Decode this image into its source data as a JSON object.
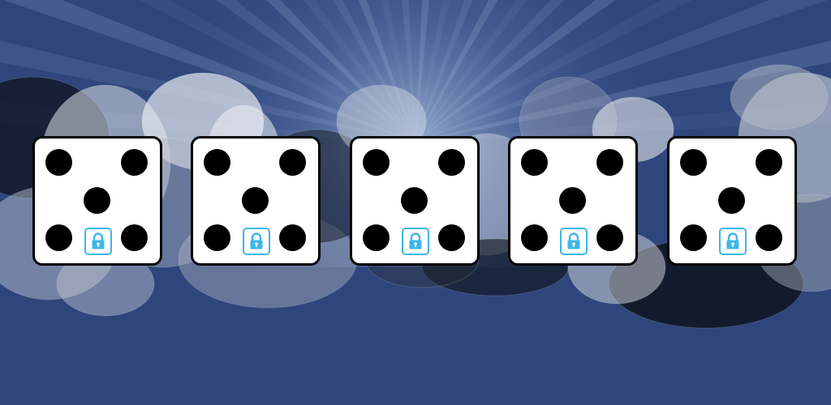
{
  "game": {
    "background_color": "#2e467c",
    "die_face_color": "#ffffff",
    "pip_color": "#000000",
    "lock_color": "#3db6ea"
  },
  "dice": [
    {
      "value": 5,
      "icon": "lock-icon"
    },
    {
      "value": 5,
      "icon": "lock-icon"
    },
    {
      "value": 5,
      "icon": "lock-icon"
    },
    {
      "value": 5,
      "icon": "lock-icon"
    },
    {
      "value": 5,
      "icon": "lock-icon"
    }
  ]
}
